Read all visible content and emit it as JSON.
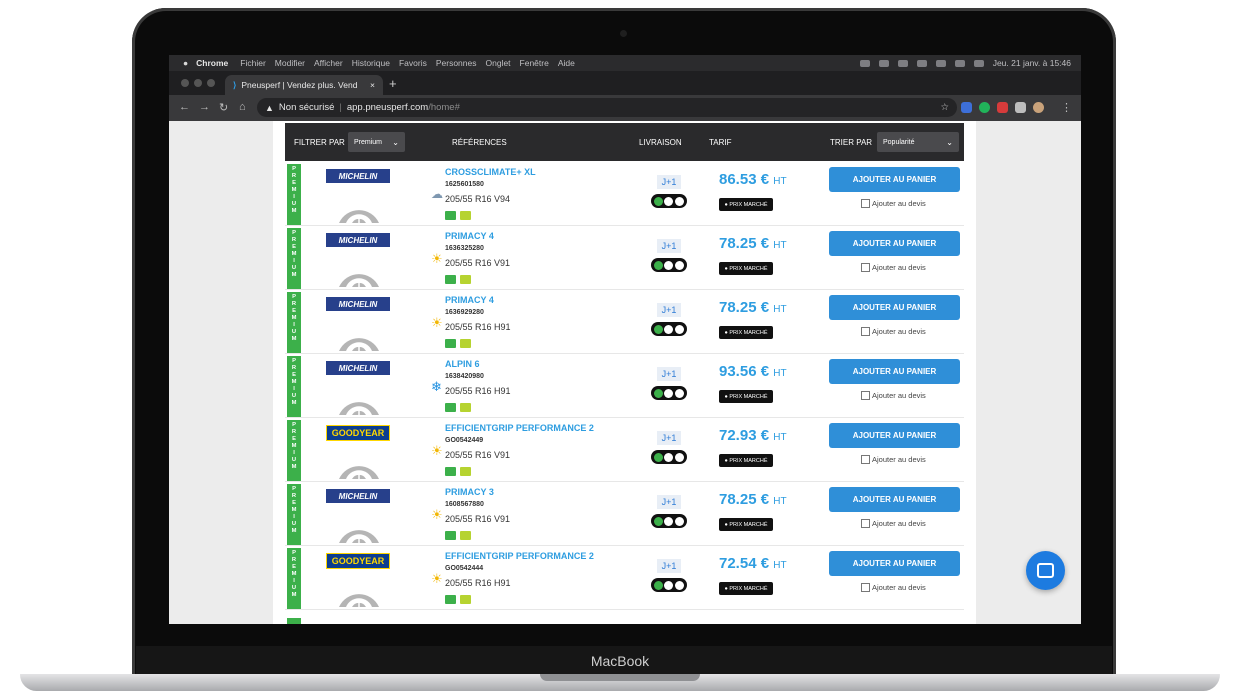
{
  "device": {
    "brand": "MacBook"
  },
  "menubar": {
    "app": "Chrome",
    "items": [
      "Fichier",
      "Modifier",
      "Afficher",
      "Historique",
      "Favoris",
      "Personnes",
      "Onglet",
      "Fenêtre",
      "Aide"
    ],
    "clock": "Jeu. 21 janv. à 15:46"
  },
  "browser": {
    "tab_title": "Pneusperf | Vendez plus. Vend",
    "tab_close": "×",
    "new_tab": "+",
    "security": "Non sécurisé",
    "url_host": "app.pneusperf.com",
    "url_path": "/home#"
  },
  "filters": {
    "filter_label": "FILTRER PAR",
    "filter_value": "Premium",
    "references": "RÉFÉRENCES",
    "livraison": "LIVRAISON",
    "tarif": "TARIF",
    "sort_label": "TRIER PAR",
    "sort_value": "Popularité"
  },
  "common": {
    "premium_letters": [
      "P",
      "R",
      "E",
      "M",
      "I",
      "U",
      "M"
    ],
    "delivery": "J+1",
    "market": "● PRIX MARCHÉ",
    "cart": "AJOUTER AU PANIER",
    "devis": "Ajouter au devis",
    "ht": "HT"
  },
  "products": [
    {
      "brand": "MICHELIN",
      "season": "all-season",
      "name": "CROSSCLIMATE+ XL",
      "ref": "1625601580",
      "size": "205/55 R16 V94",
      "labels": [
        "B",
        "B"
      ],
      "price": "86.53 €"
    },
    {
      "brand": "MICHELIN",
      "season": "summer",
      "name": "PRIMACY 4",
      "ref": "1636325280",
      "size": "205/55 R16 V91",
      "labels": [
        "A",
        "B"
      ],
      "price": "78.25 €"
    },
    {
      "brand": "MICHELIN",
      "season": "summer",
      "name": "PRIMACY 4",
      "ref": "1636929280",
      "size": "205/55 R16 H91",
      "labels": [
        "A",
        "B"
      ],
      "price": "78.25 €"
    },
    {
      "brand": "MICHELIN",
      "season": "winter",
      "name": "ALPIN 6",
      "ref": "1638420980",
      "size": "205/55 R16 H91",
      "labels": [
        "B",
        "B"
      ],
      "price": "93.56 €"
    },
    {
      "brand": "GOODYEAR",
      "season": "summer",
      "name": "EFFICIENTGRIP PERFORMANCE 2",
      "ref": "GO0542449",
      "size": "205/55 R16 V91",
      "labels": [
        "A",
        "B"
      ],
      "price": "72.93 €"
    },
    {
      "brand": "MICHELIN",
      "season": "summer",
      "name": "PRIMACY 3",
      "ref": "1608567880",
      "size": "205/55 R16 V91",
      "labels": [
        "A",
        "B"
      ],
      "price": "78.25 €"
    },
    {
      "brand": "GOODYEAR",
      "season": "summer",
      "name": "EFFICIENTGRIP PERFORMANCE 2",
      "ref": "GO0542444",
      "size": "205/55 R16 H91",
      "labels": [
        "A",
        "B"
      ],
      "price": "72.54 €"
    }
  ],
  "colors": {
    "accent": "#2e9de0",
    "premium": "#3cb04a",
    "button": "#2f8fd8"
  }
}
